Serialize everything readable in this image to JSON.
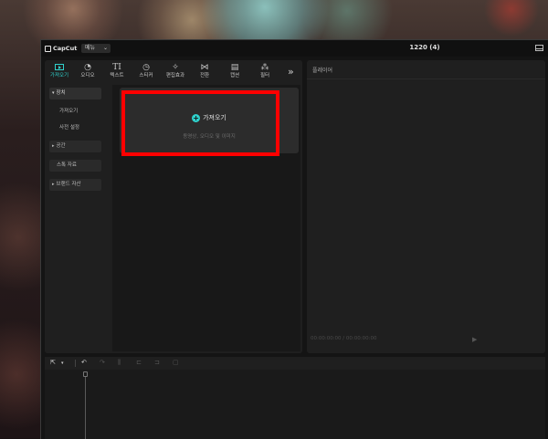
{
  "app": {
    "logo_text": "CapCut",
    "menu_label": "메뉴",
    "project_title": "1220 (4)"
  },
  "toolbar": [
    {
      "label": "가져오기",
      "icon": "media-icon",
      "active": true
    },
    {
      "label": "오디오",
      "icon": "audio-icon",
      "active": false
    },
    {
      "label": "텍스트",
      "icon": "text-icon",
      "glyph": "TI",
      "active": false
    },
    {
      "label": "스티커",
      "icon": "sticker-icon",
      "active": false
    },
    {
      "label": "편집효과",
      "icon": "effects-icon",
      "active": false
    },
    {
      "label": "전환",
      "icon": "transition-icon",
      "active": false
    },
    {
      "label": "캡션",
      "icon": "caption-icon",
      "active": false
    },
    {
      "label": "필터",
      "icon": "filter-icon",
      "active": false
    }
  ],
  "sidebar": {
    "items": [
      {
        "label": "장치",
        "caret": "▾"
      },
      {
        "label": "가져오기"
      },
      {
        "label": "사전 설정"
      },
      {
        "label": "공간",
        "caret": "▸"
      },
      {
        "label": "스톡 자료"
      },
      {
        "label": "브랜드 자산",
        "caret": "▸"
      }
    ]
  },
  "import_card": {
    "button_label": "가져오기",
    "subtext": "동영상, 오디오 및 이미지"
  },
  "player": {
    "title": "플레이어",
    "time": "00:00:00:00 / 00:00:00:00"
  },
  "colors": {
    "accent": "#2fd1cc",
    "highlight": "#ff0000"
  }
}
